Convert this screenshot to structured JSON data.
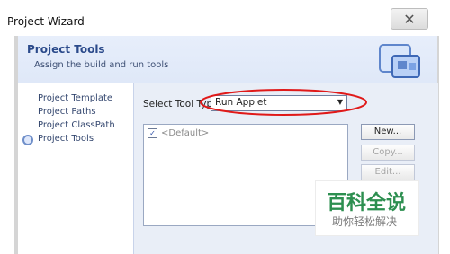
{
  "window": {
    "title": "Project Wizard",
    "close_label": "✕"
  },
  "header": {
    "title": "Project Tools",
    "subtitle": "Assign the build and run tools"
  },
  "nav": {
    "items": [
      {
        "label": "Project Template"
      },
      {
        "label": "Project Paths"
      },
      {
        "label": "Project ClassPath"
      },
      {
        "label": "Project Tools"
      }
    ],
    "active_index": 3
  },
  "tools": {
    "label": "Select Tool Type:",
    "selected": "Run Applet",
    "arrow": "▼"
  },
  "list": {
    "items": [
      {
        "label": "<Default>",
        "checked": true,
        "check_glyph": "✓"
      }
    ]
  },
  "buttons": {
    "new": "New...",
    "copy": "Copy...",
    "edit": "Edit..."
  },
  "watermark": {
    "big": "百科全说",
    "small": "助你轻松解决"
  },
  "colors": {
    "header_title": "#2b4a8b",
    "annotation": "#e01919",
    "watermark": "#2d8f50"
  }
}
